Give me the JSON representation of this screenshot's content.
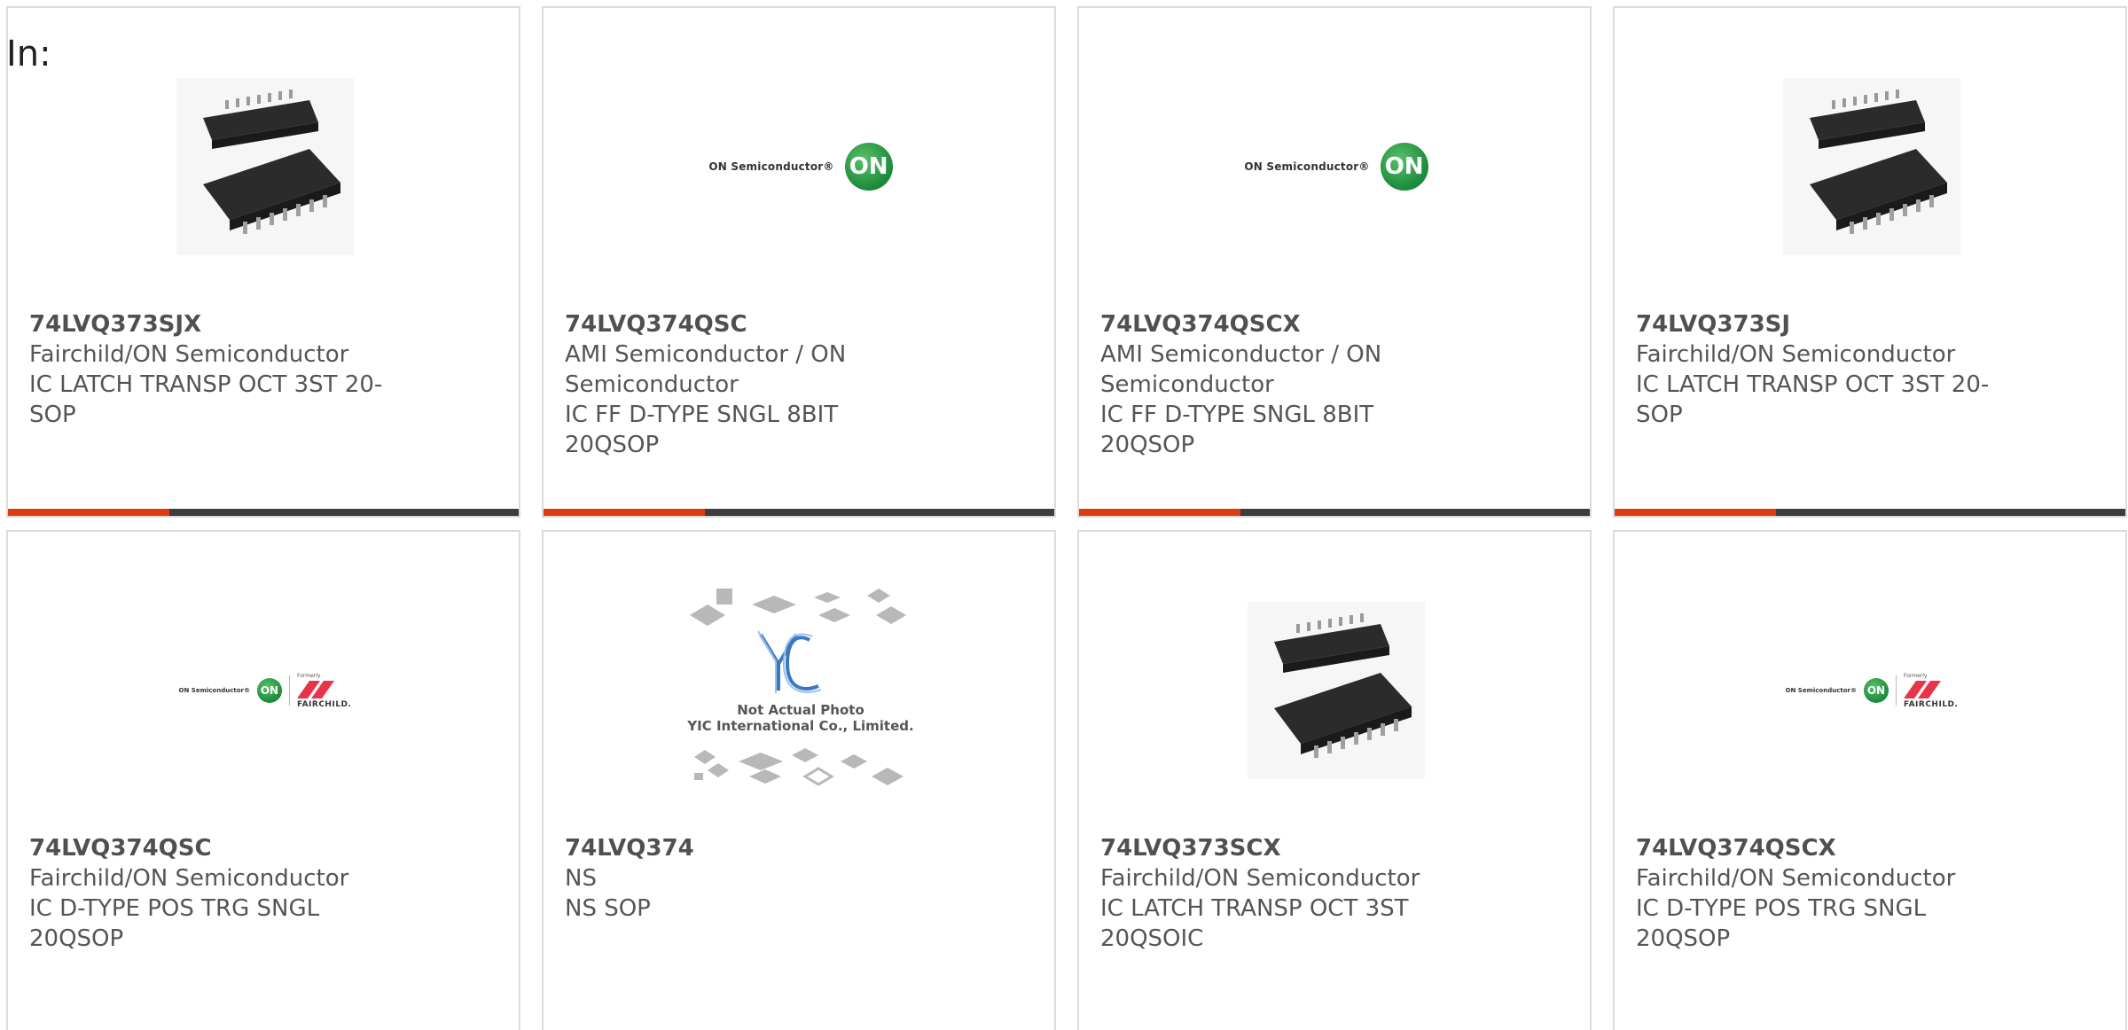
{
  "header": {
    "label": "In:"
  },
  "products": [
    {
      "part": "74LVQ373SJX",
      "manufacturer": "Fairchild/ON Semiconductor",
      "description": "IC LATCH TRANSP OCT 3ST 20-SOP",
      "image": "chip-photo"
    },
    {
      "part": "74LVQ374QSC",
      "manufacturer": "AMI Semiconductor / ON Semiconductor",
      "description": "IC FF D-TYPE SNGL 8BIT 20QSOP",
      "image": "on-semiconductor-logo"
    },
    {
      "part": "74LVQ374QSCX",
      "manufacturer": "AMI Semiconductor / ON Semiconductor",
      "description": "IC FF D-TYPE SNGL 8BIT 20QSOP",
      "image": "on-semiconductor-logo"
    },
    {
      "part": "74LVQ373SJ",
      "manufacturer": "Fairchild/ON Semiconductor",
      "description": "IC LATCH TRANSP OCT 3ST 20-SOP",
      "image": "chip-photo"
    },
    {
      "part": "74LVQ374QSC",
      "manufacturer": "Fairchild/ON Semiconductor",
      "description": "IC D-TYPE POS TRG SNGL 20QSOP",
      "image": "on-fairchild-logo"
    },
    {
      "part": "74LVQ374",
      "manufacturer": "NS",
      "description": "NS SOP",
      "image": "not-actual-photo",
      "image_caption_1": "Not Actual Photo",
      "image_caption_2": "YIC International Co., Limited."
    },
    {
      "part": "74LVQ373SCX",
      "manufacturer": "Fairchild/ON Semiconductor",
      "description": "IC LATCH TRANSP OCT 3ST 20QSOIC",
      "image": "chip-photo"
    },
    {
      "part": "74LVQ374QSCX",
      "manufacturer": "Fairchild/ON Semiconductor",
      "description": "IC D-TYPE POS TRG SNGL 20QSOP",
      "image": "on-fairchild-logo"
    }
  ],
  "logos": {
    "on_wordmark": "ON Semiconductor®",
    "on_mark": "ON",
    "formerly": "Formerly",
    "fairchild": "FAIRCHILD."
  },
  "colors": {
    "accent": "#e03c12",
    "bar": "#3d3d3d",
    "on_green": "#1b8a3a"
  }
}
